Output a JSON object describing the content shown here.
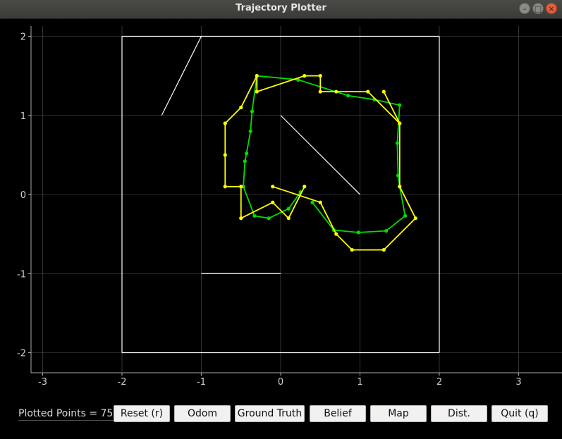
{
  "window": {
    "title": "Trajectory Plotter",
    "controls": {
      "minimize": "–",
      "maximize": "□",
      "close": "×"
    }
  },
  "plot": {
    "x_range": [
      -3.3,
      3.5
    ],
    "y_range": [
      -2.25,
      2.1
    ],
    "x_ticks": [
      -3,
      -2,
      -1,
      0,
      1,
      2,
      3
    ],
    "y_ticks": [
      -2,
      -1,
      0,
      1,
      2
    ],
    "grid": true,
    "colors": {
      "background": "#000000",
      "grid": "#555555",
      "axis": "#aaaaaa",
      "tick_label": "#d0d0d0",
      "map": "#ffffff",
      "ground_truth": "#00dd00",
      "odom": "#ffff00"
    },
    "map_segments": [
      [
        [
          -2,
          2
        ],
        [
          2,
          2
        ]
      ],
      [
        [
          2,
          2
        ],
        [
          2,
          -2
        ]
      ],
      [
        [
          2,
          -2
        ],
        [
          -2,
          -2
        ]
      ],
      [
        [
          -2,
          -2
        ],
        [
          -2,
          2
        ]
      ],
      [
        [
          -1,
          2
        ],
        [
          -1.5,
          1
        ]
      ],
      [
        [
          0,
          1
        ],
        [
          1,
          0
        ]
      ],
      [
        [
          -1,
          -1
        ],
        [
          0,
          -1
        ]
      ]
    ],
    "series": [
      {
        "color": "#00dd00",
        "points": [
          [
            0.25,
            0.03
          ],
          [
            0.1,
            -0.18
          ],
          [
            -0.15,
            -0.3
          ],
          [
            -0.33,
            -0.27
          ],
          [
            -0.47,
            0.1
          ],
          [
            -0.45,
            0.42
          ],
          [
            -0.43,
            0.52
          ],
          [
            -0.38,
            0.8
          ],
          [
            -0.36,
            1.05
          ],
          [
            -0.3,
            1.5
          ],
          [
            0.22,
            1.45
          ],
          [
            0.85,
            1.25
          ],
          [
            1.18,
            1.2
          ],
          [
            1.5,
            1.13
          ],
          [
            1.47,
            0.65
          ],
          [
            1.48,
            0.24
          ],
          [
            1.5,
            0.1
          ],
          [
            1.57,
            -0.27
          ],
          [
            1.33,
            -0.46
          ],
          [
            0.98,
            -0.48
          ],
          [
            0.67,
            -0.45
          ],
          [
            0.4,
            -0.1
          ]
        ]
      },
      {
        "color": "#ffff00",
        "points": [
          [
            0.3,
            0.1
          ],
          [
            0.1,
            -0.3
          ],
          [
            -0.1,
            -0.1
          ],
          [
            -0.5,
            -0.3
          ],
          [
            -0.5,
            0.1
          ],
          [
            -0.7,
            0.1
          ],
          [
            -0.7,
            0.5
          ],
          [
            -0.7,
            0.9
          ],
          [
            -0.5,
            1.1
          ],
          [
            -0.3,
            1.5
          ],
          [
            -0.3,
            1.3
          ],
          [
            0.3,
            1.5
          ],
          [
            0.5,
            1.5
          ],
          [
            0.5,
            1.3
          ],
          [
            0.7,
            1.3
          ],
          [
            1.1,
            1.3
          ],
          [
            1.5,
            0.9
          ],
          [
            1.3,
            1.3
          ],
          [
            1.5,
            0.9
          ],
          [
            1.5,
            0.1
          ],
          [
            1.7,
            -0.3
          ],
          [
            1.3,
            -0.7
          ],
          [
            0.9,
            -0.7
          ],
          [
            0.7,
            -0.5
          ],
          [
            0.5,
            -0.1
          ],
          [
            -0.1,
            0.1
          ]
        ]
      }
    ]
  },
  "status": {
    "label": "Plotted Points = 75"
  },
  "buttons": {
    "reset": "Reset (r)",
    "odom": "Odom",
    "ground_truth": "Ground Truth",
    "belief": "Belief",
    "map": "Map",
    "dist": "Dist.",
    "quit": "Quit (q)"
  }
}
